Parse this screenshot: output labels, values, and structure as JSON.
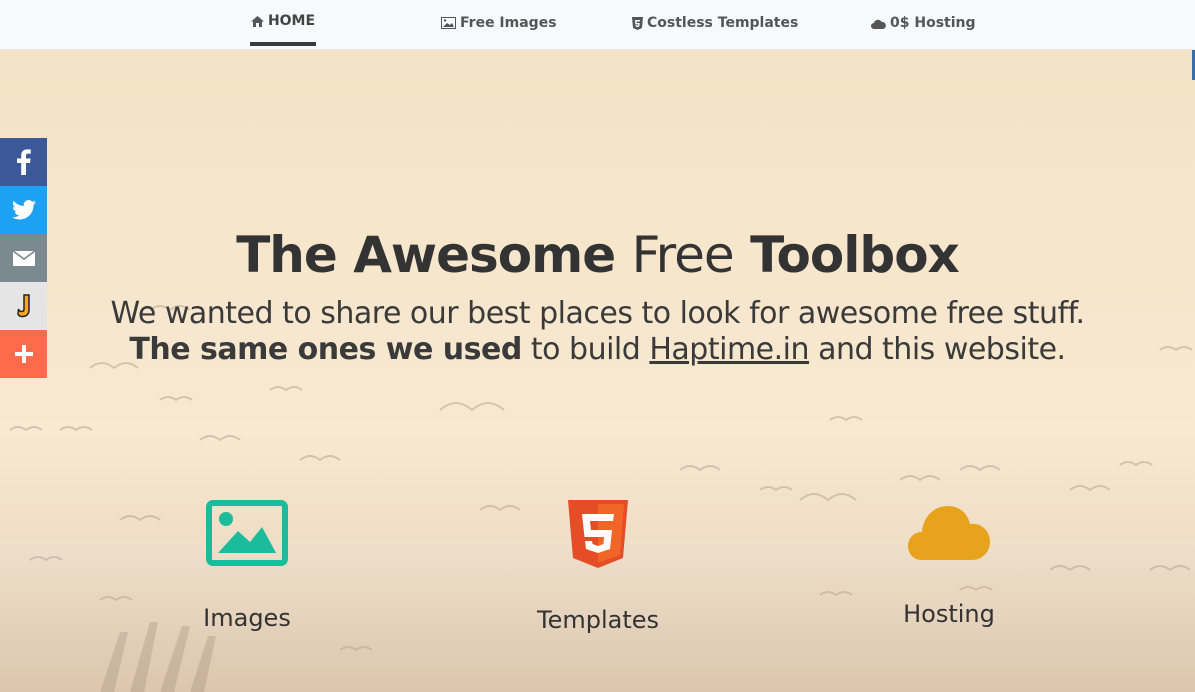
{
  "nav": {
    "items": [
      {
        "label": "HOME",
        "icon": "home-icon"
      },
      {
        "label": "Free Images",
        "icon": "image-icon"
      },
      {
        "label": "Costless Templates",
        "icon": "html5-icon"
      },
      {
        "label": "0$ Hosting",
        "icon": "cloud-icon"
      }
    ]
  },
  "social": [
    {
      "name": "facebook",
      "icon": "facebook-icon",
      "color": "#3b5998"
    },
    {
      "name": "twitter",
      "icon": "twitter-icon",
      "color": "#1da1f2"
    },
    {
      "name": "email",
      "icon": "email-icon",
      "color": "#7a8a8e"
    },
    {
      "name": "j-share",
      "icon": "j-icon",
      "color": "#e5e5e5"
    },
    {
      "name": "more",
      "icon": "plus-icon",
      "color": "#ff6a4d"
    }
  ],
  "hero": {
    "title_part1": "The Awesome",
    "title_part2": "Free",
    "title_part3": "Toolbox",
    "subtitle_line1": "We wanted to share our best places to look for awesome free stuff.",
    "subtitle_bold": "The same ones we used",
    "subtitle_mid": "to build",
    "subtitle_link": "Haptime.in",
    "subtitle_end": "and this website."
  },
  "features": [
    {
      "label": "Images",
      "icon": "image-icon",
      "color": "#1abc9c"
    },
    {
      "label": "Templates",
      "icon": "html5-icon",
      "color": "#e44d26"
    },
    {
      "label": "Hosting",
      "icon": "cloud-icon",
      "color": "#e8a31e"
    }
  ]
}
